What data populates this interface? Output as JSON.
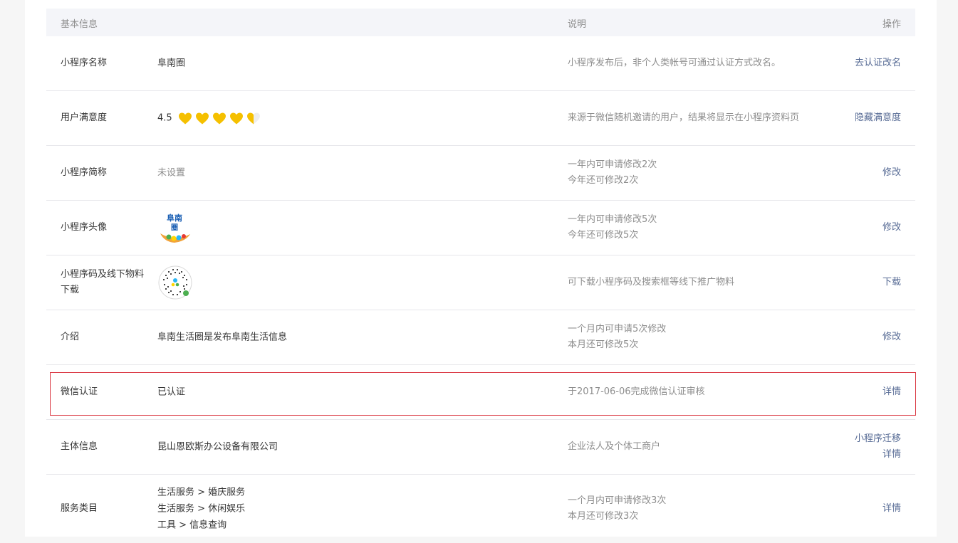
{
  "header": {
    "col_basic": "基本信息",
    "col_desc": "说明",
    "col_action": "操作"
  },
  "rows": {
    "name": {
      "label": "小程序名称",
      "value": "阜南圈",
      "desc": "小程序发布后，非个人类帐号可通过认证方式改名。",
      "action": "去认证改名"
    },
    "satisfaction": {
      "label": "用户满意度",
      "value": "4.5",
      "hearts_full": 4,
      "hearts_half": 1,
      "heart_color": "#f5c000",
      "desc": "来源于微信随机邀请的用户，结果将显示在小程序资料页",
      "action": "隐藏满意度"
    },
    "short_name": {
      "label": "小程序简称",
      "value": "未设置",
      "desc_line1": "一年内可申请修改2次",
      "desc_line2": "今年还可修改2次",
      "action": "修改"
    },
    "avatar": {
      "label": "小程序头像",
      "logo_text_1": "阜南",
      "logo_text_2": "圈",
      "desc_line1": "一年内可申请修改5次",
      "desc_line2": "今年还可修改5次",
      "action": "修改"
    },
    "qrcode": {
      "label": "小程序码及线下物料下载",
      "desc": "可下载小程序码及搜索框等线下推广物料",
      "action": "下载"
    },
    "intro": {
      "label": "介绍",
      "value": "阜南生活圈是发布阜南生活信息",
      "desc_line1": "一个月内可申请5次修改",
      "desc_line2": "本月还可修改5次",
      "action": "修改"
    },
    "wechat_cert": {
      "label": "微信认证",
      "value": "已认证",
      "desc": "于2017-06-06完成微信认证审核",
      "action": "详情"
    },
    "entity": {
      "label": "主体信息",
      "value": "昆山恩欧斯办公设备有限公司",
      "desc": "企业法人及个体工商户",
      "action_1": "小程序迁移",
      "action_2": "详情"
    },
    "category": {
      "label": "服务类目",
      "values": [
        "生活服务 > 婚庆服务",
        "生活服务 > 休闲娱乐",
        "工具 > 信息查询"
      ],
      "desc_line1": "一个月内可申请修改3次",
      "desc_line2": "本月还可修改3次",
      "action": "详情"
    }
  },
  "colors": {
    "link": "#576b95",
    "highlight_border": "#d9303b"
  }
}
